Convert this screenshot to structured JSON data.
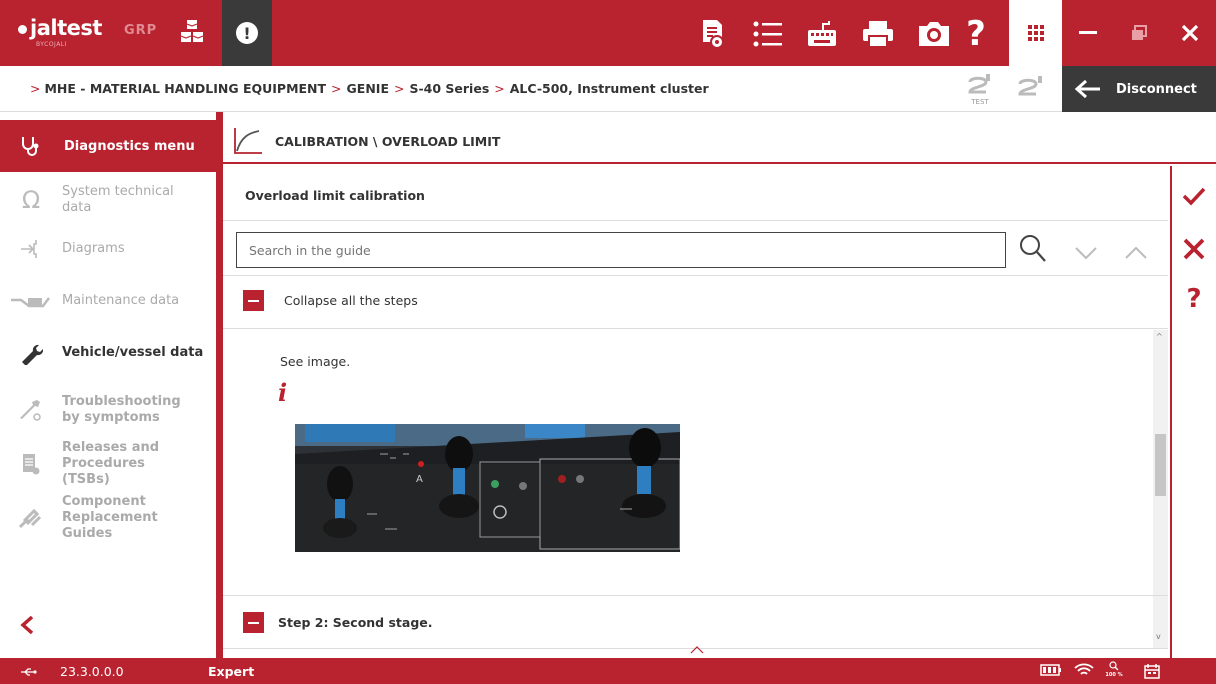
{
  "app": {
    "brand": "jaltest",
    "brand_sub": "BYCOJALI",
    "grp": "GRP"
  },
  "breadcrumb": {
    "lead": ">",
    "items": [
      "MHE - MATERIAL HANDLING EQUIPMENT",
      "GENIE",
      "S-40 Series",
      "ALC-500, Instrument cluster"
    ],
    "sep": ">"
  },
  "toolbar": {
    "test_label": "TEST",
    "disconnect_label": "Disconnect"
  },
  "sidebar": {
    "active": "Diagnostics menu",
    "items": [
      {
        "label": "System technical data",
        "icon": "omega-icon"
      },
      {
        "label": "Diagrams",
        "icon": "diagram-icon"
      },
      {
        "label": "Maintenance data",
        "icon": "oil-can-icon"
      },
      {
        "label": "Vehicle/vessel data",
        "icon": "wrench-icon"
      },
      {
        "label": "Troubleshooting by symptoms",
        "icon": "tools-icon"
      },
      {
        "label": "Releases and Procedures (TSBs)",
        "icon": "document-icon"
      },
      {
        "label": "Component Replacement Guides",
        "icon": "replace-icon"
      }
    ]
  },
  "main": {
    "section_title": "CALIBRATION \\ OVERLOAD LIMIT",
    "guide_title": "Overload limit calibration",
    "search_placeholder": "Search in the guide",
    "collapse_label": "Collapse all the steps",
    "see_image": "See image.",
    "photo_label": "A",
    "step2_label": "Step 2: Second stage."
  },
  "status": {
    "version": "23.3.0.0.0",
    "mode": "Expert",
    "zoom": "100 %"
  },
  "colors": {
    "brand_red": "#b8232f",
    "dark": "#3a3a3a"
  }
}
